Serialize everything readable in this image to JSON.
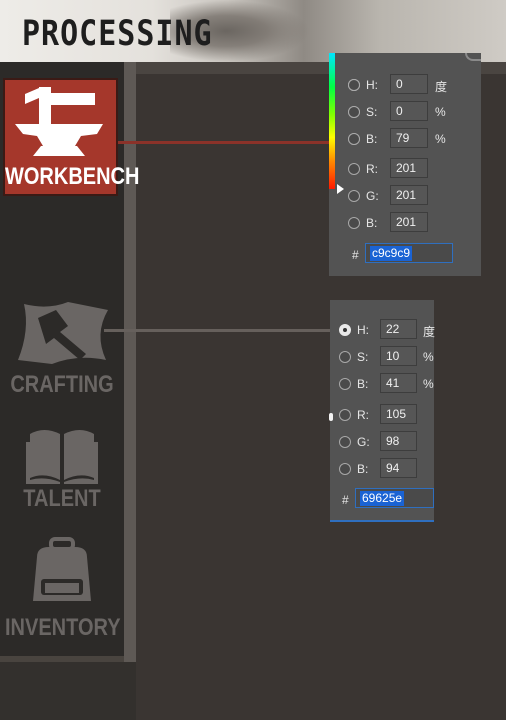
{
  "header": {
    "title": "PROCESSING"
  },
  "sidebar": {
    "items": [
      {
        "label": "WORKBENCH",
        "icon": "anvil-hammer-icon",
        "active": true
      },
      {
        "label": "CRAFTING",
        "icon": "hammer-flag-icon",
        "active": false
      },
      {
        "label": "TALENT",
        "icon": "open-book-icon",
        "active": false
      },
      {
        "label": "INVENTORY",
        "icon": "backpack-icon",
        "active": false
      }
    ]
  },
  "picker1": {
    "rows": [
      {
        "label": "H:",
        "value": "0",
        "unit": "度"
      },
      {
        "label": "S:",
        "value": "0",
        "unit": "%"
      },
      {
        "label": "B:",
        "value": "79",
        "unit": "%"
      },
      {
        "label": "R:",
        "value": "201",
        "unit": ""
      },
      {
        "label": "G:",
        "value": "201",
        "unit": ""
      },
      {
        "label": "B:",
        "value": "201",
        "unit": ""
      }
    ],
    "hash": "#",
    "hex": "c9c9c9"
  },
  "picker2": {
    "rows": [
      {
        "label": "H:",
        "value": "22",
        "unit": "度"
      },
      {
        "label": "S:",
        "value": "10",
        "unit": "%"
      },
      {
        "label": "B:",
        "value": "41",
        "unit": "%"
      },
      {
        "label": "R:",
        "value": "105",
        "unit": ""
      },
      {
        "label": "G:",
        "value": "98",
        "unit": ""
      },
      {
        "label": "B:",
        "value": "94",
        "unit": ""
      }
    ],
    "hash": "#",
    "hex": "69625e"
  },
  "colors": {
    "active_tile": "#a5372b",
    "inactive_icon": "#6a6664",
    "red_connector": "#8b3229",
    "gray_connector": "#66605c"
  }
}
